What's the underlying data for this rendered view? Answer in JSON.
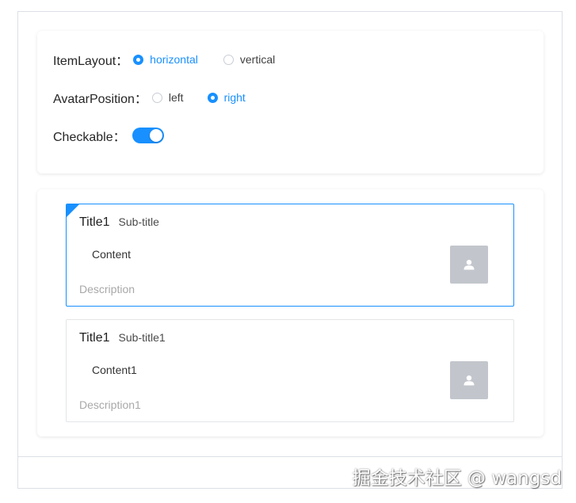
{
  "settings": {
    "item_layout": {
      "label": "ItemLayout：",
      "options": [
        {
          "label": "horizontal",
          "checked": true
        },
        {
          "label": "vertical",
          "checked": false
        }
      ]
    },
    "avatar_position": {
      "label": "AvatarPosition：",
      "options": [
        {
          "label": "left",
          "checked": false
        },
        {
          "label": "right",
          "checked": true
        }
      ]
    },
    "checkable": {
      "label": "Checkable：",
      "value": true
    }
  },
  "list": {
    "items": [
      {
        "title": "Title1",
        "subtitle": "Sub-title",
        "content": "Content",
        "description": "Description",
        "checked": true,
        "avatar_icon": "user-icon"
      },
      {
        "title": "Title1",
        "subtitle": "Sub-title1",
        "content": "Content1",
        "description": "Description1",
        "checked": false,
        "avatar_icon": "user-icon"
      }
    ]
  },
  "watermark": "掘金技术社区 @ wangsd",
  "colors": {
    "accent": "#1890ff",
    "avatar_bg": "#c2c6cc",
    "border": "#dcdfe6"
  }
}
